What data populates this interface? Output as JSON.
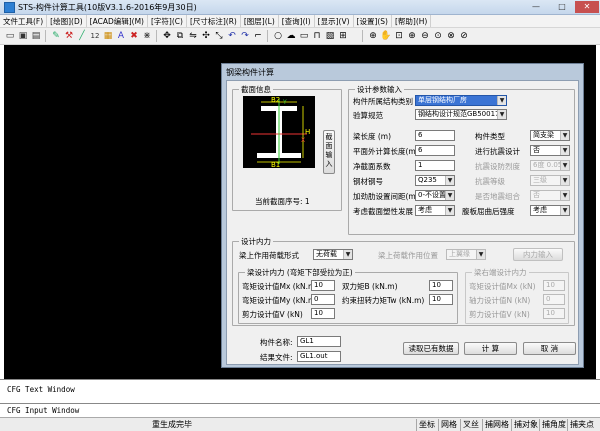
{
  "window": {
    "title": "STS-构件计算工具(10版V3.1.6-2016年9月30日)",
    "min": "—",
    "max": "□",
    "close": "✕"
  },
  "menus": [
    "文件工具(F)",
    "[绘图](D)",
    "[ACAD编辑](M)",
    "[字符](C)",
    "[尺寸标注](R)",
    "[图层](L)",
    "[查询](I)",
    "[显示](V)",
    "[设置](S)",
    "[帮助](H)"
  ],
  "dialog": {
    "title": "钢梁构件计算",
    "section": {
      "group": "截面信息",
      "labels": {
        "b2": "B2",
        "b1": "B1",
        "h": "H",
        "y": "Y",
        "x": "X"
      },
      "input_button": "截面输入",
      "number": "当前截面序号: 1"
    },
    "params": {
      "group": "设计参数输入",
      "struct_type": {
        "label": "构件所属结构类别",
        "value": "单层钢结构厂房"
      },
      "code": {
        "label": "验算规范",
        "value": "钢结构设计规范GB50017"
      },
      "beam_length": {
        "label": "梁长度 (m)",
        "value": "6"
      },
      "member_type": {
        "label": "构件类型",
        "value": "简支梁"
      },
      "out_plane_length": {
        "label": "平面外计算长度(m)",
        "value": "6"
      },
      "seismic_design": {
        "label": "进行抗震设计",
        "value": "否"
      },
      "net_section": {
        "label": "净截面系数",
        "value": "1"
      },
      "seismic_intensity": {
        "label": "抗震设防烈度",
        "value": "6度 0.05"
      },
      "steel": {
        "label": "钢材钢号",
        "value": "Q235"
      },
      "seismic_grade": {
        "label": "抗震等级",
        "value": "三级"
      },
      "stiffener": {
        "label": "加劲肋设置间距(m)",
        "value": "0-不设置"
      },
      "uppermost": {
        "label": "是否地震组合",
        "value": "否"
      },
      "plastic": {
        "label": "考虑截面塑性发展",
        "value": "考虑"
      },
      "flange": {
        "label": "腹板屈曲后强度",
        "value": "考虑"
      }
    },
    "forces": {
      "group": "设计内力",
      "load_form": {
        "label": "梁上作用荷载形式",
        "value": "无荷载"
      },
      "load_position": {
        "label": "梁上荷载作用位置",
        "value": "上翼缘"
      },
      "load_input": "内力输入",
      "left": {
        "group": "梁设计内力 (弯矩下部受拉为正)",
        "mx": {
          "label": "弯矩设计值Mx (kN.m)",
          "value": "10"
        },
        "my": {
          "label": "弯矩设计值My (kN.m)",
          "value": "0"
        },
        "v": {
          "label": "剪力设计值V (kN)",
          "value": "10"
        },
        "b": {
          "label": "双力矩B (kN.m)",
          "value": "10"
        },
        "tw": {
          "label": "约束扭转力矩Tw (kN.m)",
          "value": "10"
        }
      },
      "right": {
        "group": "梁右端设计内力",
        "mx": {
          "label": "弯矩设计值Mx (kN)",
          "value": "10"
        },
        "n": {
          "label": "轴力设计值N (kN)",
          "value": "0"
        },
        "v": {
          "label": "剪力设计值V (kN)",
          "value": "10"
        }
      }
    },
    "member_name": {
      "label": "构件名称:",
      "value": "GL1"
    },
    "result_file": {
      "label": "结果文件:",
      "value": "GL1.out"
    },
    "buttons": {
      "read": "读取已有数据",
      "calc": "计  算",
      "cancel": "取  消"
    }
  },
  "cmd": {
    "text_window": "CFG Text Window",
    "input_window": "CFG Input Window"
  },
  "status": {
    "message": "重生成完毕",
    "cells": [
      "坐标",
      "网格",
      "叉丝",
      "捕网格",
      "捕对象",
      "捕角度",
      "捕夹点"
    ]
  }
}
